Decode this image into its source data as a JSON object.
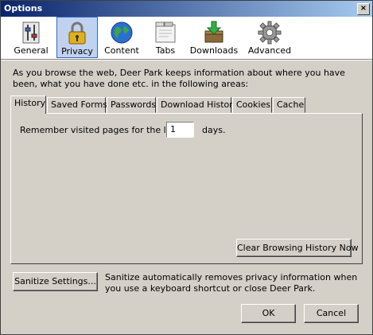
{
  "window": {
    "title": "Options",
    "close_glyph": "×"
  },
  "toolbar": {
    "items": [
      {
        "label": "General",
        "icon": "sliders-icon"
      },
      {
        "label": "Privacy",
        "icon": "padlock-icon",
        "selected": true
      },
      {
        "label": "Content",
        "icon": "globe-icon"
      },
      {
        "label": "Tabs",
        "icon": "tabs-icon"
      },
      {
        "label": "Downloads",
        "icon": "downloads-icon"
      },
      {
        "label": "Advanced",
        "icon": "gear-icon"
      }
    ]
  },
  "description": "As you browse the web, Deer Park keeps information about where you have been, what you have done etc. in the following areas:",
  "tabs": [
    {
      "label": "History",
      "active": true
    },
    {
      "label": "Saved Forms"
    },
    {
      "label": "Passwords"
    },
    {
      "label": "Download History"
    },
    {
      "label": "Cookies"
    },
    {
      "label": "Cache"
    }
  ],
  "history": {
    "remember_label": "Remember visited pages for the last",
    "days_value": "1",
    "days_unit": "days.",
    "clear_button": "Clear Browsing History Now"
  },
  "sanitize": {
    "button": "Sanitize Settings...",
    "text": "Sanitize automatically removes privacy information when you use a keyboard shortcut or close Deer Park."
  },
  "buttons": {
    "ok": "OK",
    "cancel": "Cancel"
  },
  "colors": {
    "titlebar_start": "#0a246a",
    "titlebar_end": "#a6caf0",
    "dialog_bg": "#d4d0c8",
    "selected_bg": "#c1d2ee"
  }
}
